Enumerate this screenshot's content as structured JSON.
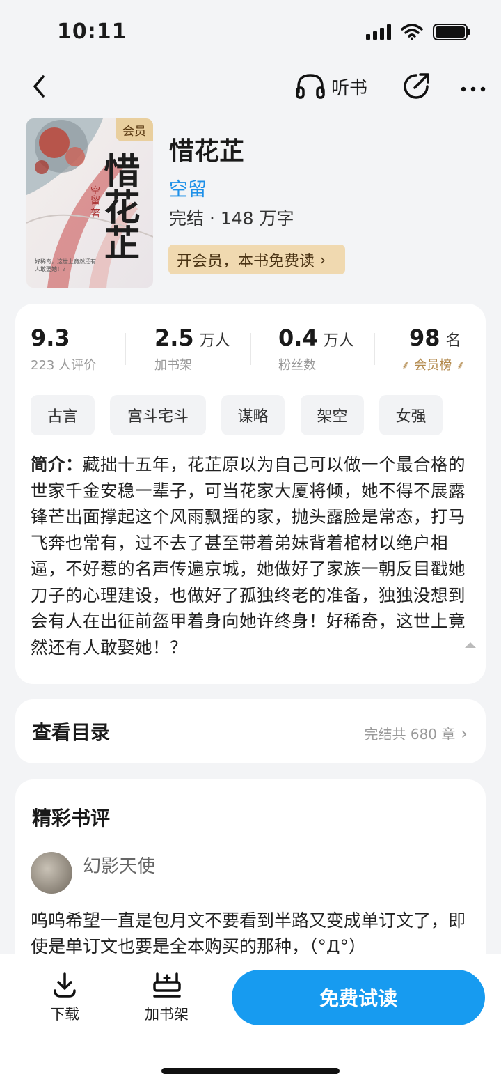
{
  "status_bar": {
    "time": "10:11"
  },
  "nav": {
    "listen_label": "听书",
    "icons": [
      "back-icon",
      "headphones-icon",
      "share-icon",
      "more-icon"
    ]
  },
  "book": {
    "cover_badge": "会员",
    "cover_title": "惜花芷",
    "cover_author": "空留 著",
    "cover_tagline": "好稀奇，这世上竟然还有人敢娶她！？",
    "title": "惜花芷",
    "author": "空留",
    "status_words": "完结 · 148 万字",
    "vip_button": "开会员，本书免费读"
  },
  "stats": [
    {
      "num": "9.3",
      "unit": "",
      "sub": "223 人评价"
    },
    {
      "num": "2.5",
      "unit": "万人",
      "sub": "加书架"
    },
    {
      "num": "0.4",
      "unit": "万人",
      "sub": "粉丝数"
    },
    {
      "num": "98",
      "unit": "名",
      "sub": "会员榜"
    }
  ],
  "tags": [
    "古言",
    "宫斗宅斗",
    "谋略",
    "架空",
    "女强"
  ],
  "intro": {
    "label": "简介：",
    "text": "藏拙十五年，花芷原以为自己可以做一个最合格的世家千金安稳一辈子，可当花家大厦将倾，她不得不展露锋芒出面撑起这个风雨飘摇的家，抛头露脸是常态，打马飞奔也常有，过不去了甚至带着弟妹背着棺材以绝户相逼，不好惹的名声传遍京城，她做好了家族一朝反目戳她刀子的心理建设，也做好了孤独终老的准备，独独没想到会有人在出征前盔甲着身向她许终身！好稀奇，这世上竟然还有人敢娶她！？"
  },
  "catalog": {
    "label": "查看目录",
    "info": "完结共 680 章"
  },
  "reviews": {
    "heading": "精彩书评",
    "user": "幻影天使",
    "text": "呜呜希望一直是包月文不要看到半路又变成单订文了，即使是单订文也要是全本购买的那种，（°Д°）"
  },
  "bottom_bar": {
    "download": "下载",
    "add_shelf": "加书架",
    "read": "免费试读"
  },
  "colors": {
    "accent": "#179bf0",
    "author_link": "#1e90e8",
    "vip_bg": "#f0d9b0",
    "gold": "#b38a4d"
  }
}
